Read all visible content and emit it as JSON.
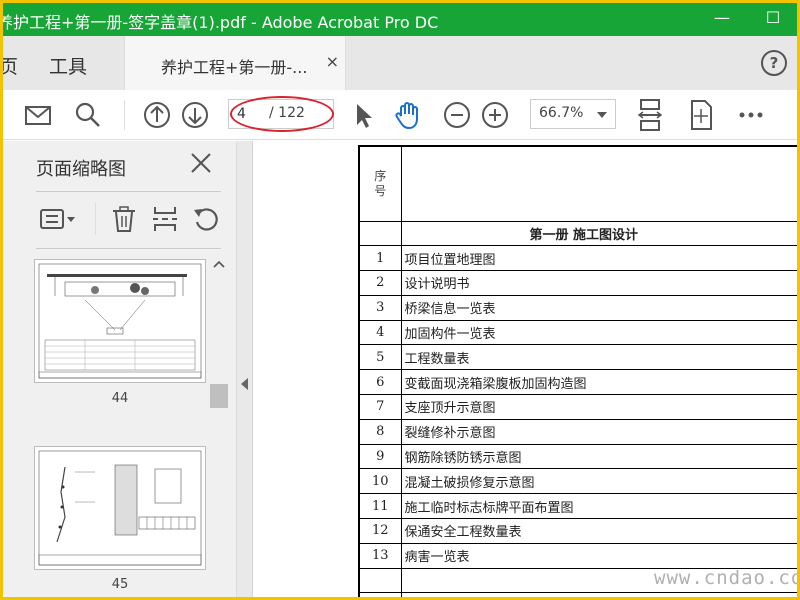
{
  "window": {
    "title": "养护工程+第一册-签字盖章(1).pdf - Adobe Acrobat Pro DC",
    "minimize": "—",
    "maximize": "☐"
  },
  "tabs": {
    "home": "页",
    "tools": "工具",
    "document": "养护工程+第一册-...",
    "close": "×",
    "help": "?"
  },
  "toolbar": {
    "current_page": "4",
    "total_pages": "/ 122",
    "zoom": "66.7%"
  },
  "panel": {
    "title": "页面缩略图",
    "thumbnails": [
      {
        "page": "44"
      },
      {
        "page": "45"
      }
    ]
  },
  "document": {
    "header_label": "序号",
    "section_title": "第一册 施工图设计",
    "rows": [
      {
        "num": "1",
        "title": "项目位置地理图"
      },
      {
        "num": "2",
        "title": "设计说明书"
      },
      {
        "num": "3",
        "title": "桥梁信息一览表"
      },
      {
        "num": "4",
        "title": "加固构件一览表"
      },
      {
        "num": "5",
        "title": "工程数量表"
      },
      {
        "num": "6",
        "title": "变截面现浇箱梁腹板加固构造图"
      },
      {
        "num": "7",
        "title": "支座顶升示意图"
      },
      {
        "num": "8",
        "title": "裂缝修补示意图"
      },
      {
        "num": "9",
        "title": "钢筋除锈防锈示意图"
      },
      {
        "num": "10",
        "title": "混凝土破损修复示意图"
      },
      {
        "num": "11",
        "title": "施工临时标志标牌平面布置图"
      },
      {
        "num": "12",
        "title": "保通安全工程数量表"
      },
      {
        "num": "13",
        "title": "病害一览表"
      }
    ]
  },
  "watermark": "www.cndao.com",
  "colors": {
    "title_bar": "#17a537",
    "frame": "#f2c400",
    "highlight": "#d9232f",
    "hand_tool": "#1a6fcf"
  }
}
